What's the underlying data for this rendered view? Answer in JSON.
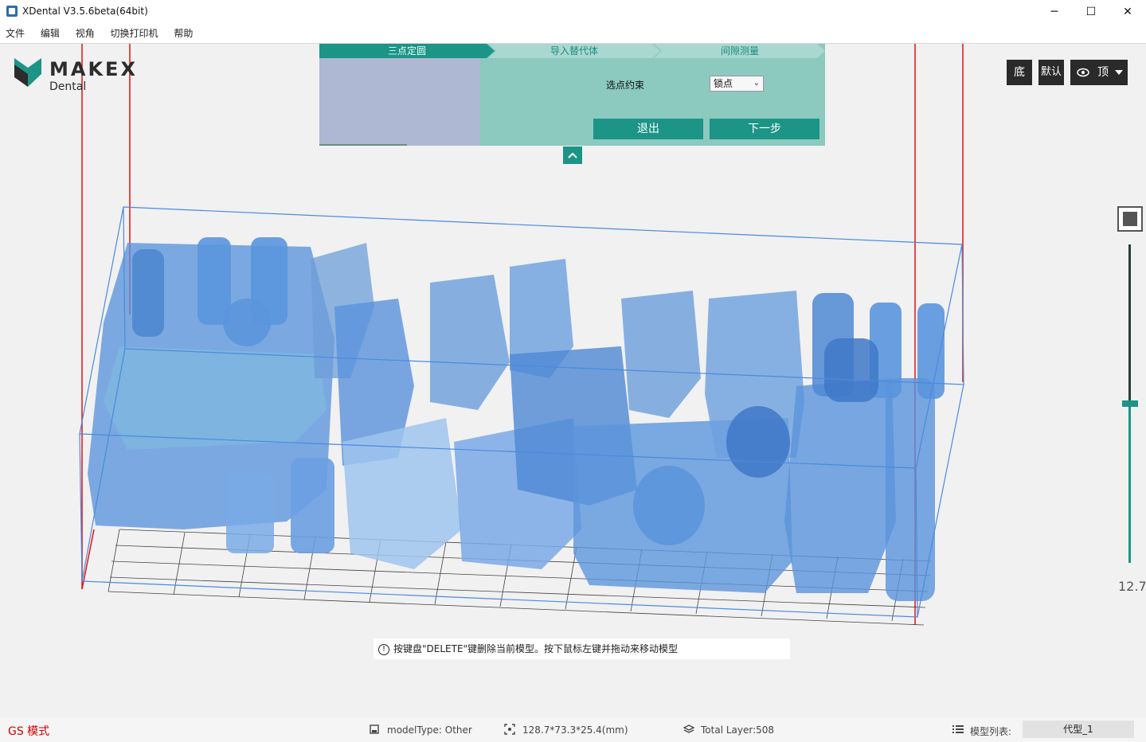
{
  "app": {
    "title": "XDental V3.5.6beta(64bit)",
    "window_controls": [
      "─",
      "☐",
      "✕"
    ]
  },
  "menu": [
    "文件",
    "编辑",
    "视角",
    "切换打印机",
    "帮助"
  ],
  "logo": {
    "brand": "MAKEX",
    "sub": "Dental"
  },
  "wizard": {
    "steps": [
      "三点定圆",
      "导入替代体",
      "间隙测量"
    ],
    "active_step": 0,
    "constraint_label": "选点约束",
    "constraint_value": "锁点",
    "exit_label": "退出",
    "next_label": "下一步",
    "collapse_icon": "chevron-up-icon"
  },
  "view_buttons": {
    "bottom": "底",
    "default": "默认",
    "top": "顶",
    "eye_icon": "eye-icon",
    "dropdown_icon": "caret-down-icon"
  },
  "layer_slider": {
    "value": "12.7",
    "level": 0.5
  },
  "hint": "按键盘\"DELETE\"键删除当前模型。按下鼠标左键并拖动来移动模型",
  "status": {
    "mode": "GS 模式",
    "model_type": "modelType: Other",
    "dimensions": "128.7*73.3*25.4(mm)",
    "total_layer": "Total Layer:508",
    "model_list_label": "模型列表:",
    "model_list_value": "代型_1"
  },
  "colors": {
    "accent": "#1c9486",
    "wizard_bg": "#8cc9bf",
    "model_blue": "#5a94dc",
    "bbox_line": "#4a8ae0",
    "axis_red": "#e02020"
  }
}
